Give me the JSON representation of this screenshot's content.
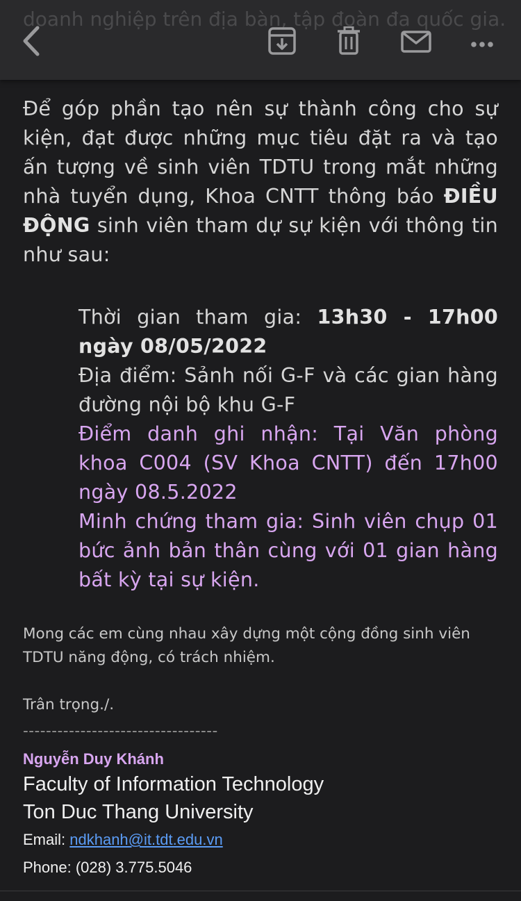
{
  "toolbar": {
    "ghost_text": "doanh nghiệp trên địa bàn, tập đoàn đa quốc gia.",
    "back_icon": "chevron-left-icon",
    "archive_icon": "archive-icon",
    "trash_icon": "trash-icon",
    "mail_icon": "mail-icon",
    "more_icon": "more-icon"
  },
  "body": {
    "intro_part1": "Để góp phần tạo nên sự thành công cho sự kiện, đạt được những mục tiêu đặt ra và tạo ấn tượng về sinh viên TDTU trong mắt những nhà tuyển dụng, Khoa CNTT thông báo ",
    "intro_bold": "ĐIỀU ĐỘNG",
    "intro_part2": " sinh viên tham dự sự kiện với thông tin như sau:",
    "time_label": "Thời gian tham gia: ",
    "time_value": "13h30 - 17h00 ngày 08/05/2022",
    "location": "Địa điểm: Sảnh nối G-F và các gian hàng đường nội bộ khu G-F",
    "checkin": "Điểm danh ghi nhận: Tại Văn phòng khoa C004 (SV Khoa CNTT) đến 17h00 ngày 08.5.2022",
    "proof": "Minh chứng tham gia: Sinh viên chụp 01 bức ảnh bản thân cùng với 01 gian hàng bất kỳ tại sự kiện.",
    "closing": "Mong các em cùng nhau xây dựng một cộng đồng sinh viên TDTU năng động, có trách nhiệm.",
    "regards": "Trân trọng./.",
    "divider": "----------------------------------"
  },
  "signature": {
    "name": "Nguyễn Duy Khánh",
    "faculty": "Faculty of Information Technology",
    "university": "Ton Duc Thang University",
    "email_label": "Email: ",
    "email": "ndkhanh@it.tdt.edu.vn",
    "phone": "Phone: (028) 3.775.5046"
  },
  "colors": {
    "background": "#1c1c1e",
    "toolbar": "#2a2a2c",
    "accent_purple": "#d8a6f0",
    "link": "#5b9cf5"
  }
}
